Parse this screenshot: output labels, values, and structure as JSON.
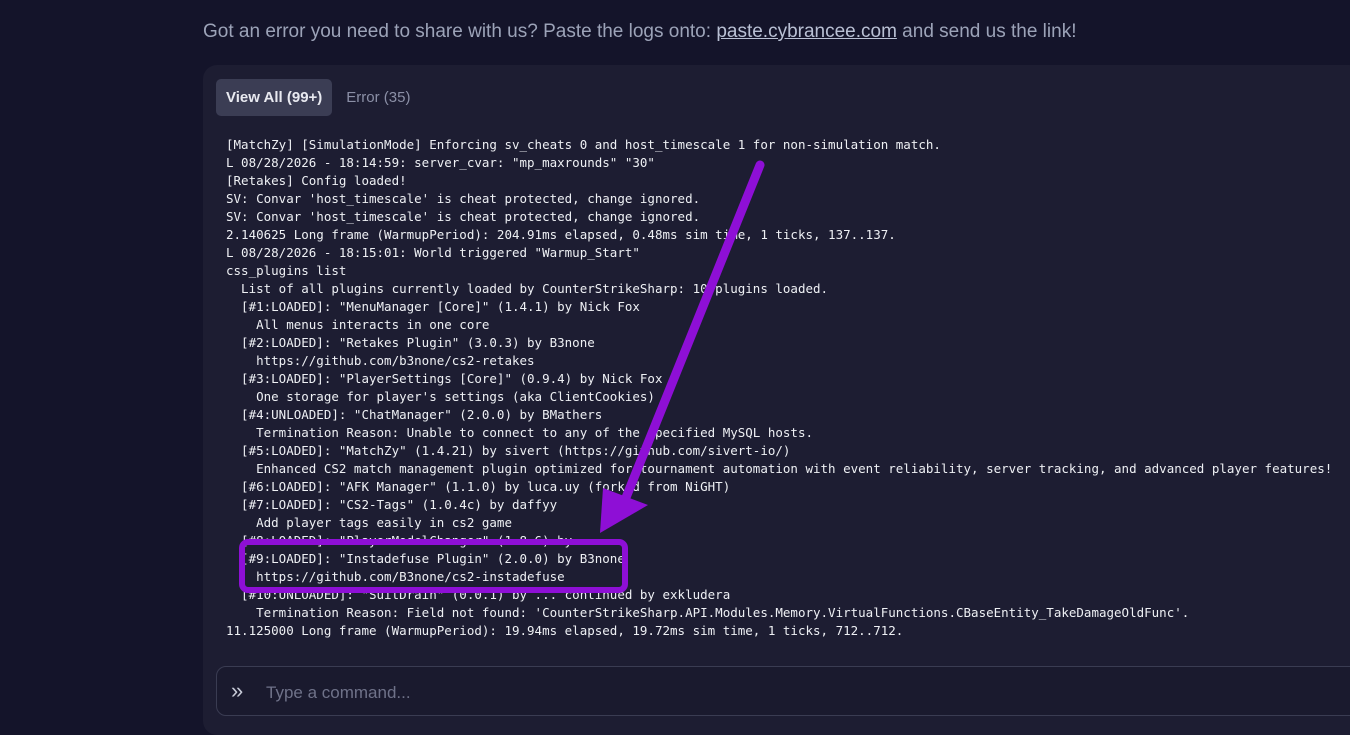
{
  "help": {
    "prefix": "Got an error you need to share with us? Paste the logs onto: ",
    "link": "paste.cybrancee.com",
    "suffix": " and send us the link!"
  },
  "tabs": [
    {
      "label": "View All (99+)",
      "active": true
    },
    {
      "label": "Error (35)",
      "active": false
    }
  ],
  "log_lines": [
    "[MatchZy] [SimulationMode] Enforcing sv_cheats 0 and host_timescale 1 for non-simulation match.",
    "L 08/28/2026 - 18:14:59: server_cvar: \"mp_maxrounds\" \"30\"",
    "[Retakes] Config loaded!",
    "SV: Convar 'host_timescale' is cheat protected, change ignored.",
    "SV: Convar 'host_timescale' is cheat protected, change ignored.",
    "2.140625 Long frame (WarmupPeriod): 204.91ms elapsed, 0.48ms sim time, 1 ticks, 137..137.",
    "L 08/28/2026 - 18:15:01: World triggered \"Warmup_Start\"",
    "css_plugins list",
    "  List of all plugins currently loaded by CounterStrikeSharp: 10 plugins loaded.",
    "  [#1:LOADED]: \"MenuManager [Core]\" (1.4.1) by Nick Fox",
    "    All menus interacts in one core",
    "  [#2:LOADED]: \"Retakes Plugin\" (3.0.3) by B3none",
    "    https://github.com/b3none/cs2-retakes",
    "  [#3:LOADED]: \"PlayerSettings [Core]\" (0.9.4) by Nick Fox",
    "    One storage for player's settings (aka ClientCookies)",
    "  [#4:UNLOADED]: \"ChatManager\" (2.0.0) by BMathers",
    "    Termination Reason: Unable to connect to any of the specified MySQL hosts.",
    "  [#5:LOADED]: \"MatchZy\" (1.4.21) by sivert (https://github.com/sivert-io/)",
    "    Enhanced CS2 match management plugin optimized for tournament automation with event reliability, server tracking, and advanced player features!",
    "  [#6:LOADED]: \"AFK Manager\" (1.1.0) by luca.uy (forked from NiGHT)",
    "  [#7:LOADED]: \"CS2-Tags\" (1.0.4c) by daffyy",
    "    Add player tags easily in cs2 game",
    "  [#8:LOADED]: \"PlayerModelChanger\" (1.8.6) by ...",
    "  [#9:LOADED]: \"Instadefuse Plugin\" (2.0.0) by B3none",
    "    https://github.com/B3none/cs2-instadefuse",
    "  [#10:UNLOADED]: \"SuitDrain\" (0.0.1) by ... continued by exkludera",
    "    Termination Reason: Field not found: 'CounterStrikeSharp.API.Modules.Memory.VirtualFunctions.CBaseEntity_TakeDamageOldFunc'.",
    "11.125000 Long frame (WarmupPeriod): 19.94ms elapsed, 19.72ms sim time, 1 ticks, 712..712."
  ],
  "command": {
    "prompt_icon": "double-chevron-right-icon",
    "placeholder": "Type a command..."
  },
  "annotation": {
    "color": "#8e0fd6",
    "arrow_icon": "arrow-icon",
    "highlight_target": "[#9:LOADED] Instadefuse Plugin"
  }
}
